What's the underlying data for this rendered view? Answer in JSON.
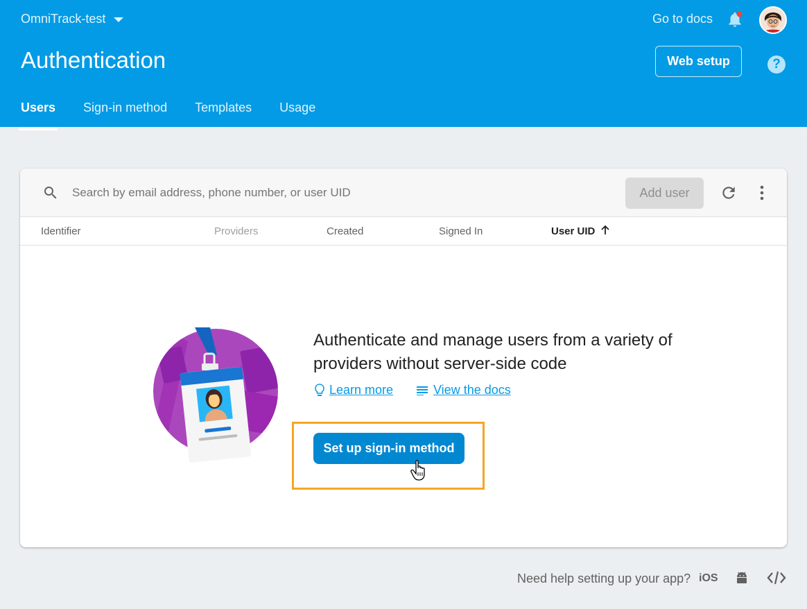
{
  "header": {
    "project_name": "OmniTrack-test",
    "docs_link": "Go to docs",
    "title": "Authentication",
    "web_setup_label": "Web setup",
    "help_label": "?"
  },
  "tabs": [
    {
      "label": "Users",
      "active": true
    },
    {
      "label": "Sign-in method",
      "active": false
    },
    {
      "label": "Templates",
      "active": false
    },
    {
      "label": "Usage",
      "active": false
    }
  ],
  "toolbar": {
    "search_placeholder": "Search by email address, phone number, or user UID",
    "add_user_label": "Add user"
  },
  "table": {
    "columns": [
      "Identifier",
      "Providers",
      "Created",
      "Signed In",
      "User UID"
    ],
    "sorted_column": "User UID",
    "sort_direction": "ascending"
  },
  "empty_state": {
    "title": "Authenticate and manage users from a variety of providers without server-side code",
    "learn_more": "Learn more",
    "view_docs": "View the docs",
    "cta_label": "Set up sign-in method"
  },
  "footer": {
    "help_text": "Need help setting up your app?",
    "ios_label": "iOS"
  },
  "colors": {
    "header_bg": "#039be5",
    "primary_button": "#0288d1",
    "highlight": "#f5a623",
    "link": "#039be5"
  },
  "icons": [
    "caret-down-icon",
    "bell-icon",
    "help-icon",
    "search-icon",
    "refresh-icon",
    "more-vert-icon",
    "arrow-up-icon",
    "lightbulb-icon",
    "notes-icon",
    "hand-cursor-icon",
    "android-icon",
    "code-icon"
  ]
}
